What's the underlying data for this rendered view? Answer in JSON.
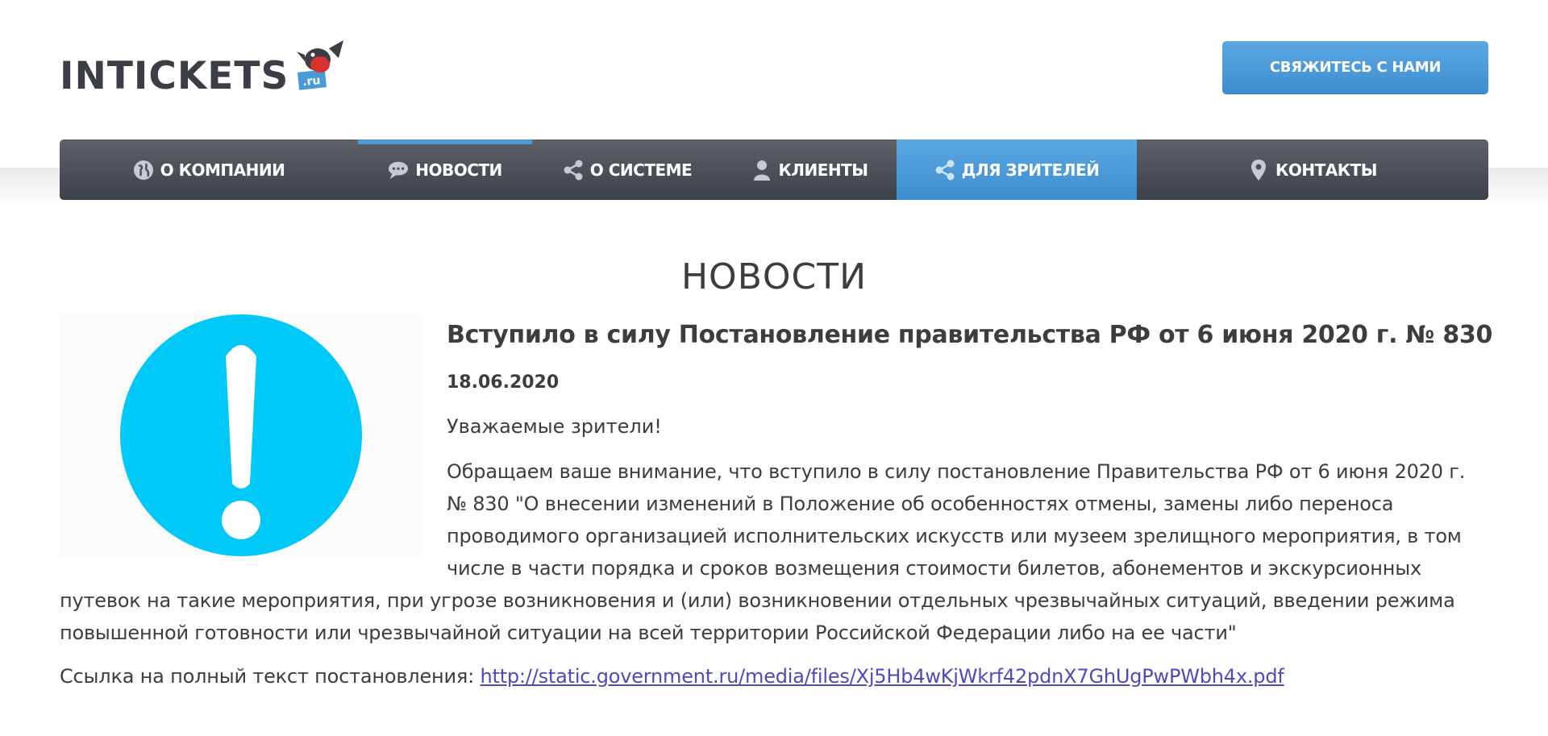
{
  "header": {
    "logo_text": "INTICKETS",
    "logo_badge": ".ru",
    "contact_button": "СВЯЖИТЕСЬ С НАМИ",
    "brand_color": "#4a9ad8"
  },
  "nav": {
    "items": [
      {
        "label": "О КОМПАНИИ",
        "icon": "globe-icon"
      },
      {
        "label": "НОВОСТИ",
        "icon": "chat-bubble-icon"
      },
      {
        "label": "О СИСТЕМЕ",
        "icon": "share-icon"
      },
      {
        "label": "КЛИЕНТЫ",
        "icon": "user-icon"
      },
      {
        "label": "ДЛЯ ЗРИТЕЛЕЙ",
        "icon": "share-icon"
      },
      {
        "label": "КОНТАКТЫ",
        "icon": "map-pin-icon"
      }
    ],
    "current": "НОВОСТИ",
    "active": "ДЛЯ ЗРИТЕЛЕЙ"
  },
  "page": {
    "title": "НОВОСТИ"
  },
  "article": {
    "image_icon": "exclamation-circle-icon",
    "title": "Вступило в силу Постановление правительства РФ от 6 июня 2020 г. № 830",
    "date": "18.06.2020",
    "greeting": "Уважаемые зрители!",
    "body_lines": [
      "Обращаем ваше внимание, что вступило в силу постановление Правительства РФ от 6 июня 2020 г.",
      "№ 830 \"О внесении изменений в Положение об особенностях отмены, замены либо переноса",
      "проводимого организацией исполнительских искусств или музеем зрелищного мероприятия, в том",
      "числе в части порядка и сроков возмещения стоимости билетов, абонементов и экскурсионных",
      "путевок на такие мероприятия, при угрозе возникновения и (или) возникновении отдельных чрезвычайных ситуаций, введении режима",
      "повышенной готовности или чрезвычайной ситуации на всей территории Российской Федерации либо на ее части\""
    ],
    "link_label": "Ссылка на полный текст постановления:",
    "link_url": "http://static.government.ru/media/files/Xj5Hb4wKjWkrf42pdnX7GhUgPwPWbh4x.pdf"
  }
}
